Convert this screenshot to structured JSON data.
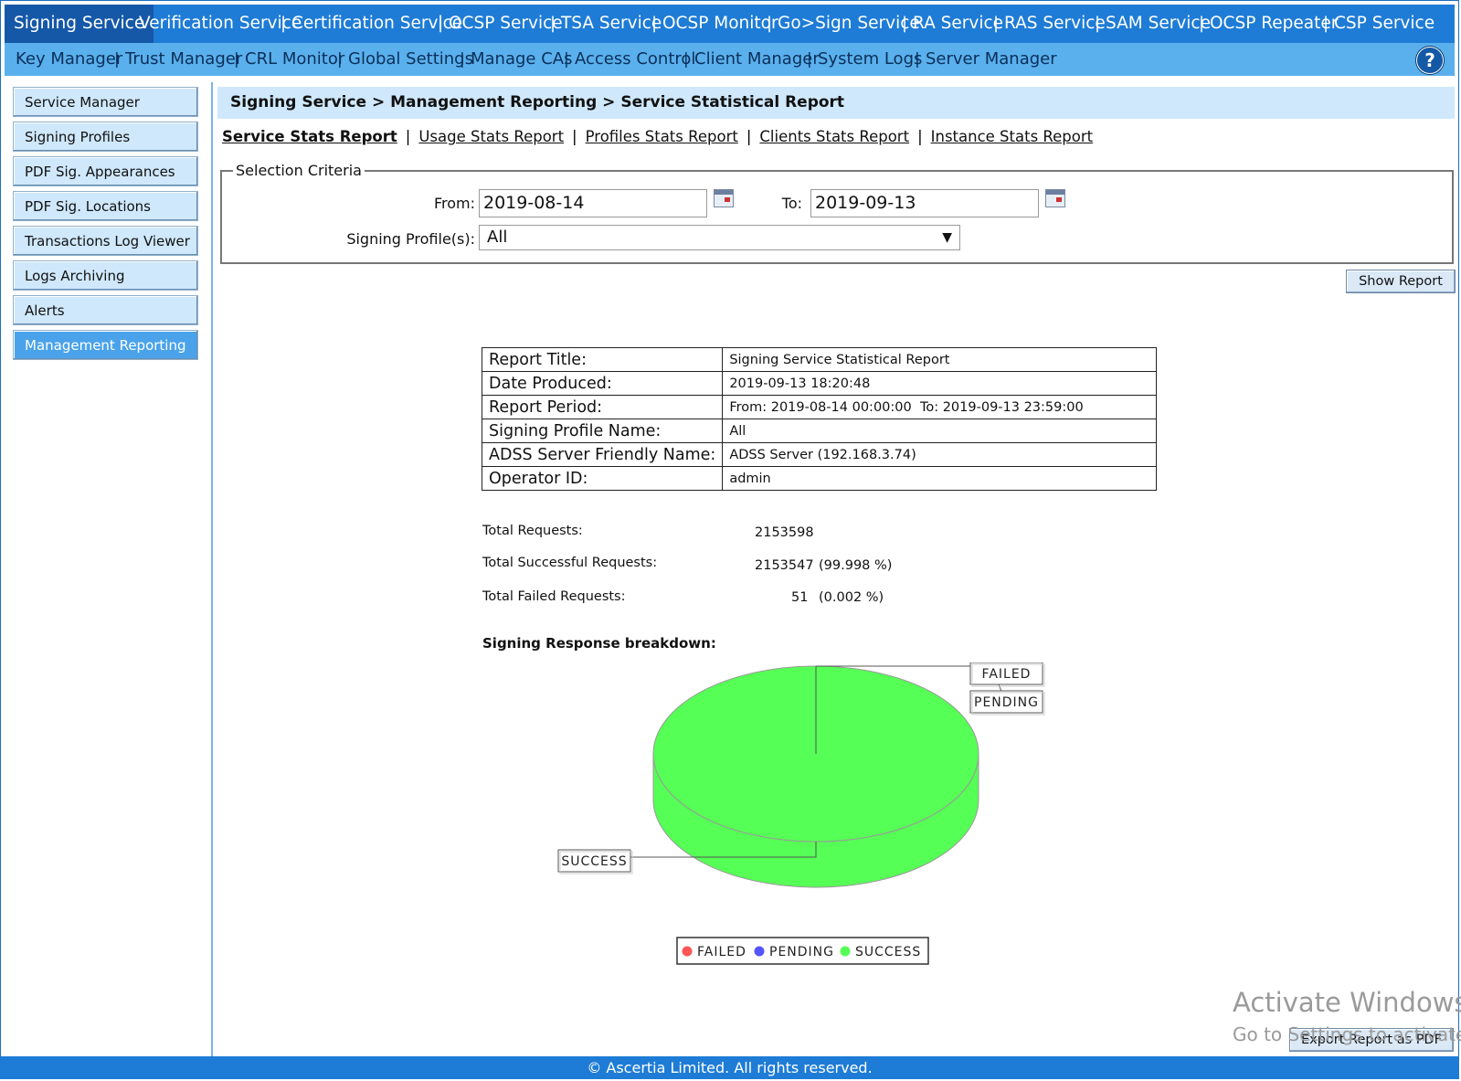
{
  "nav_primary": {
    "items": [
      "Signing Service",
      "Verification Service",
      "Certification Service",
      "OCSP Service",
      "TSA Service",
      "OCSP Monitor",
      "Go>Sign Service",
      "RA Service",
      "RAS Service",
      "SAM Service",
      "OCSP Repeater",
      "CSP Service"
    ],
    "active_index": 0
  },
  "nav_secondary": {
    "items": [
      "Key Manager",
      "Trust Manager",
      "CRL Monitor",
      "Global Settings",
      "Manage CAs",
      "Access Control",
      "Client Manager",
      "System Logs",
      "Server Manager"
    ],
    "help_label": "?"
  },
  "sidebar": {
    "items": [
      "Service Manager",
      "Signing Profiles",
      "PDF Sig. Appearances",
      "PDF Sig. Locations",
      "Transactions Log Viewer",
      "Logs Archiving",
      "Alerts",
      "Management Reporting"
    ],
    "active_index": 7
  },
  "breadcrumb": "Signing Service > Management Reporting > Service Statistical Report",
  "report_tabs": {
    "items": [
      "Service Stats Report",
      "Usage Stats Report",
      "Profiles Stats Report",
      "Clients Stats Report",
      "Instance Stats Report"
    ],
    "current_index": 0
  },
  "criteria": {
    "legend": "Selection Criteria",
    "from_label": "From:",
    "from_value": "2019-08-14",
    "to_label": "To:",
    "to_value": "2019-09-13",
    "profile_label": "Signing Profile(s):",
    "profile_value": "All"
  },
  "show_report_button": "Show Report",
  "report_info": [
    {
      "key": "Report Title:",
      "value": "Signing Service Statistical Report"
    },
    {
      "key": "Date Produced:",
      "value": "2019-09-13 18:20:48"
    },
    {
      "key": "Report Period:",
      "value": "From: 2019-08-14 00:00:00  To: 2019-09-13 23:59:00"
    },
    {
      "key": "Signing Profile Name:",
      "value": "All"
    },
    {
      "key": "ADSS Server Friendly Name:",
      "value": "ADSS Server (192.168.3.74)"
    },
    {
      "key": "Operator ID:",
      "value": "admin"
    }
  ],
  "stats": {
    "total_label": "Total Requests:",
    "total_value": "2153598",
    "success_label": "Total Successful Requests:",
    "success_value": "2153547",
    "success_pct": "(99.998 %)",
    "failed_label": "Total Failed Requests:",
    "failed_value": "51",
    "failed_pct": "(0.002 %)"
  },
  "chart_data": {
    "type": "pie",
    "title": "Signing Response breakdown:",
    "categories": [
      "FAILED",
      "PENDING",
      "SUCCESS"
    ],
    "values": [
      51,
      0,
      2153547
    ],
    "colors": [
      "#ff5555",
      "#5555ff",
      "#55ff55"
    ],
    "legend_position": "bottom-center",
    "three_d": true
  },
  "export_button": "Export Report as PDF",
  "footer": "© Ascertia Limited. All rights reserved.",
  "watermark": {
    "line1": "Activate Windows",
    "line2": "Go to Settings to activate"
  }
}
